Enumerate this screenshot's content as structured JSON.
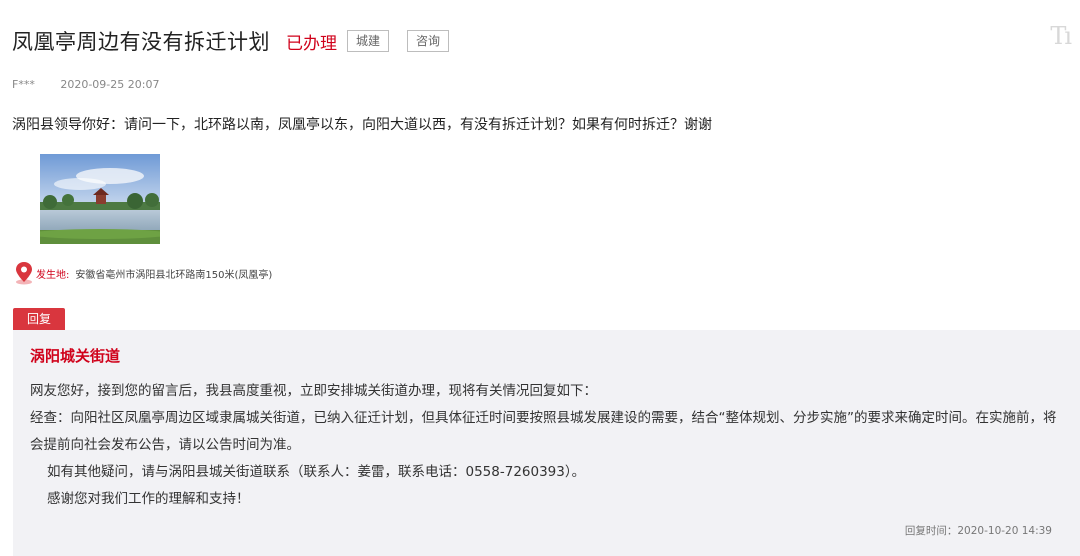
{
  "header": {
    "title": "凤凰亭周边有没有拆迁计划",
    "status": "已办理",
    "tags": [
      "城建",
      "咨询"
    ],
    "font_toggle": "Tı"
  },
  "meta": {
    "author": "F***",
    "time": "2020-09-25 20:07"
  },
  "question": "涡阳县领导你好：请问一下，北环路以南，凤凰亭以东，向阳大道以西，有没有拆迁计划？如果有何时拆迁？谢谢",
  "location": {
    "label": "发生地:",
    "address": "安徽省亳州市涡阳县北环路南150米(凤凰亭)"
  },
  "reply": {
    "badge": "回复",
    "department": "涡阳城关街道",
    "paragraphs": [
      "网友您好，接到您的留言后，我县高度重视，立即安排城关街道办理，现将有关情况回复如下：",
      "经查：向阳社区凤凰亭周边区域隶属城关街道，已纳入征迁计划，但具体征迁时间要按照县城发展建设的需要，结合“整体规划、分步实施”的要求来确定时间。在实施前，将会提前向社会发布公告，请以公告时间为准。",
      "如有其他疑问，请与涡阳县城关街道联系（联系人：姜雷，联系电话：0558-7260393）。",
      "感谢您对我们工作的理解和支持！"
    ],
    "time_label": "回复时间：2020-10-20 14:39"
  },
  "colors": {
    "accent": "#d0021b",
    "badge_bg": "#d9363e",
    "panel_bg": "#f2f2f5"
  },
  "icons": {
    "location": "map-pin-icon",
    "font_size": "font-size-icon"
  }
}
